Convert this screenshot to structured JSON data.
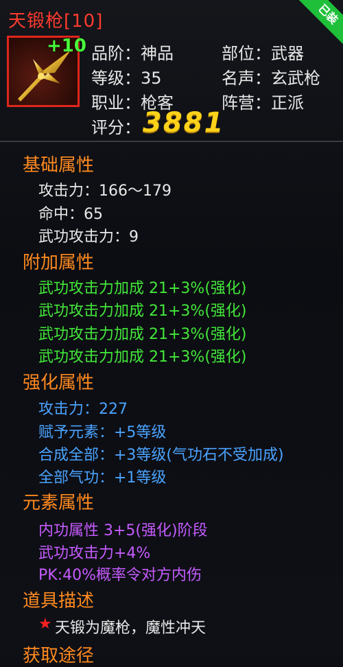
{
  "item": {
    "name": "天锻枪[10]",
    "plus_level": "+10",
    "corner_badge": "已装",
    "info": {
      "grade": "品阶：神品",
      "slot": "部位：武器",
      "level": "等级：35",
      "fame": "名声：玄武枪",
      "class": "职业：枪客",
      "faction": "阵营：正派",
      "score_label": "评分：",
      "score_value": "3881"
    }
  },
  "sections": {
    "basic_title": "基础属性",
    "basic": [
      "攻击力：166～179",
      "命中：65",
      "武功攻击力：9"
    ],
    "extra_title": "附加属性",
    "extra": [
      "武功攻击力加成 21+3%(强化)",
      "武功攻击力加成 21+3%(强化)",
      "武功攻击力加成 21+3%(强化)",
      "武功攻击力加成 21+3%(强化)"
    ],
    "enhance_title": "强化属性",
    "enhance": [
      "攻击力：227",
      "赋予元素：+5等级",
      "合成全部：+3等级(气功石不受加成)",
      "全部气功：+1等级"
    ],
    "element_title": "元素属性",
    "element": [
      "内功属性 3+5(强化)阶段",
      "武功攻击力+4%",
      "PK:40%概率令对方内伤"
    ],
    "desc_title": "道具描述",
    "desc_star": "★",
    "desc_text": "天锻为魔枪，魔性冲天",
    "source_title": "获取途径"
  },
  "colors": {
    "title": "#ff3b2e",
    "section": "#ff8a1f",
    "extra": "#43e83a",
    "enhance": "#4aa3ff",
    "element": "#c65bff",
    "score": "#ffd21a"
  },
  "icons": {
    "item_image": "golden-spear-icon",
    "star": "red-star-icon"
  }
}
